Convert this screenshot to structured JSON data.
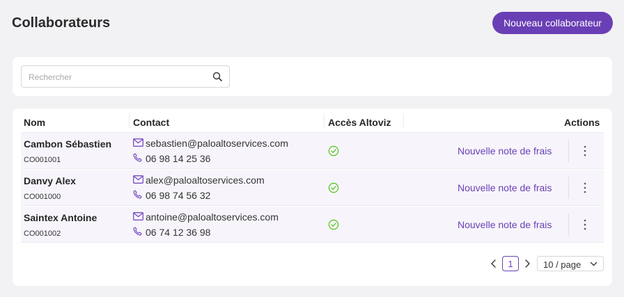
{
  "header": {
    "title": "Collaborateurs",
    "new_button_label": "Nouveau collaborateur"
  },
  "search": {
    "placeholder": "Rechercher",
    "value": ""
  },
  "table": {
    "columns": {
      "name": "Nom",
      "contact": "Contact",
      "access": "Accès Altoviz",
      "actions": "Actions"
    },
    "rows": [
      {
        "name": "Cambon Sébastien",
        "code": "CO001001",
        "email": "sebastien@paloaltoservices.com",
        "phone": "06 98 14 25 36",
        "access_icon": "check-circle-icon",
        "action_label": "Nouvelle note de frais"
      },
      {
        "name": "Danvy Alex",
        "code": "CO001000",
        "email": "alex@paloaltoservices.com",
        "phone": "06 98 74 56 32",
        "access_icon": "check-circle-icon",
        "action_label": "Nouvelle note de frais"
      },
      {
        "name": "Saintex Antoine",
        "code": "CO001002",
        "email": "antoine@paloaltoservices.com",
        "phone": "06 74 12 36 98",
        "access_icon": "check-circle-icon",
        "action_label": "Nouvelle note de frais"
      }
    ]
  },
  "pagination": {
    "current_page": "1",
    "page_size": "10 / page"
  },
  "colors": {
    "accent": "#6a3fb5",
    "success": "#52c41a",
    "background": "#f2f1f4",
    "row_background": "#f7f5fb"
  }
}
